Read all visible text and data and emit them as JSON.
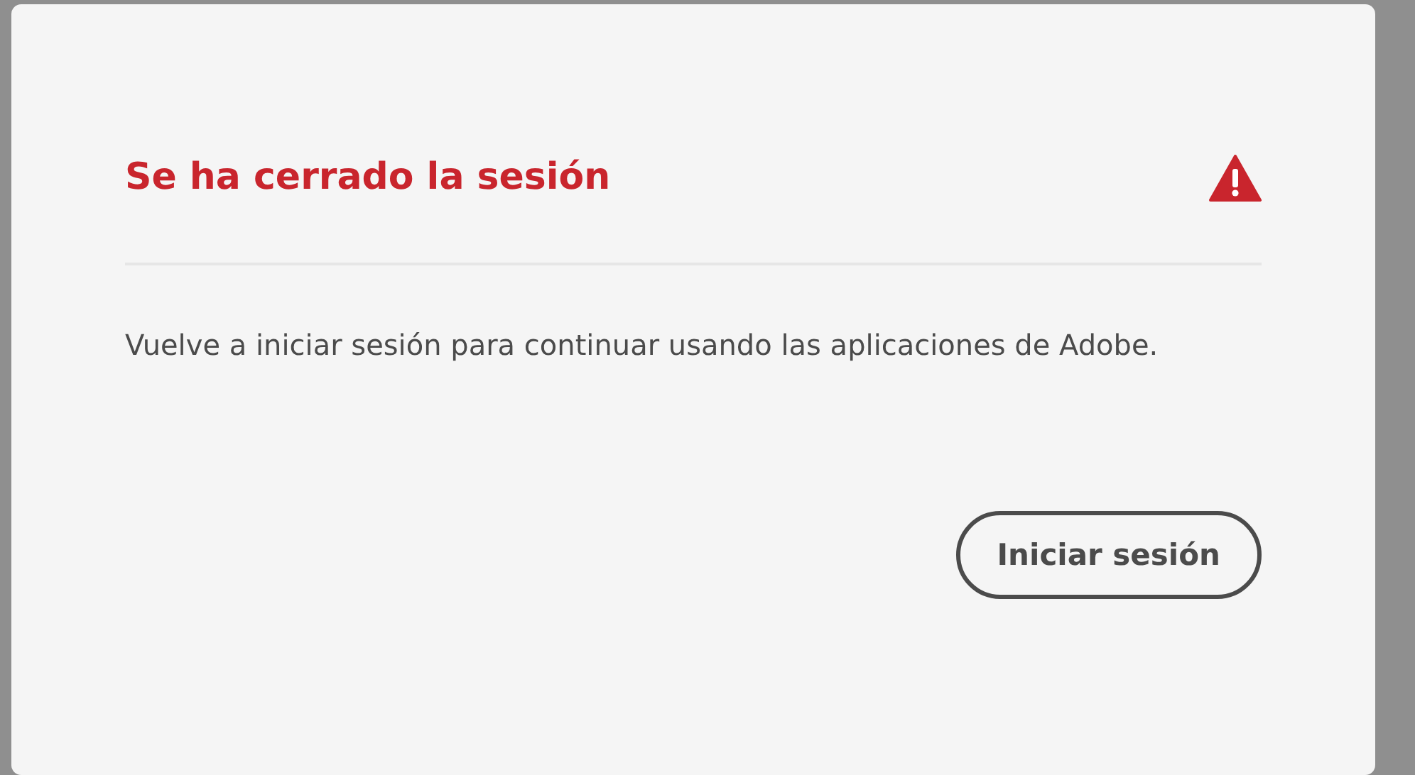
{
  "dialog": {
    "title": "Se ha cerrado la sesión",
    "message": "Vuelve a iniciar sesión para continuar usando las aplicaciones de Adobe.",
    "buttons": [
      {
        "label": "Iniciar sesión"
      }
    ]
  }
}
